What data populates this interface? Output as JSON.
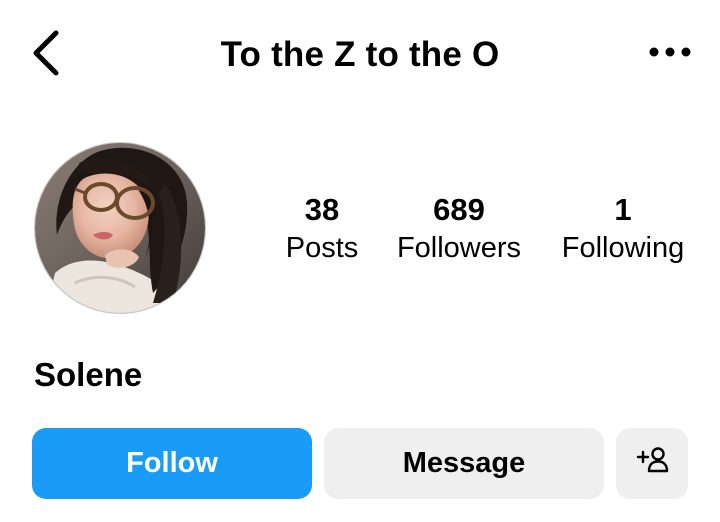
{
  "header": {
    "title": "To the Z to the O",
    "back_icon": "chevron-left-icon",
    "more_icon": "more-horizontal-icon"
  },
  "profile": {
    "name": "Solene",
    "avatar": "profile-photo"
  },
  "stats": [
    {
      "value": "38",
      "label": "Posts"
    },
    {
      "value": "689",
      "label": "Followers"
    },
    {
      "value": "1",
      "label": "Following"
    }
  ],
  "actions": {
    "follow_label": "Follow",
    "message_label": "Message",
    "suggest_icon": "add-person-icon"
  },
  "colors": {
    "follow_button": "#1a9bf7",
    "secondary_button": "#efefef",
    "text": "#000000"
  }
}
